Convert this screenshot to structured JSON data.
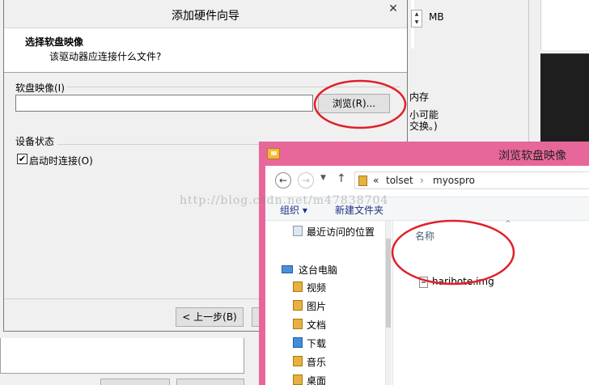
{
  "background_window": {
    "unit_label": "MB",
    "memory_label": "内存",
    "note_line1": "小可能",
    "note_line2": "交换。)"
  },
  "wizard": {
    "title": "添加硬件向导",
    "close_glyph": "✕",
    "heading": "选择软盘映像",
    "subheading": "该驱动器应连接什么文件?",
    "image_group_label": "软盘映像(I)",
    "image_path_value": "",
    "browse_button": "浏览(R)...",
    "device_status_label": "设备状态",
    "connect_at_power_on": "启动时连接(O)",
    "connect_checked": true,
    "back_button": "< 上一步(B)"
  },
  "browse_dialog": {
    "title": "浏览软盘映像",
    "path_prefix": "«",
    "path_segments": [
      "tolset",
      "myospro"
    ],
    "path_separator": "›",
    "toolbar": {
      "organize": "组织 ▾",
      "new_folder": "新建文件夹"
    },
    "nav_items": [
      {
        "label": "最近访问的位置",
        "icon": "recent-locations-icon"
      },
      {
        "label": "这台电脑",
        "icon": "computer-icon"
      },
      {
        "label": "视频",
        "icon": "folder-icon"
      },
      {
        "label": "图片",
        "icon": "folder-icon"
      },
      {
        "label": "文档",
        "icon": "folder-icon"
      },
      {
        "label": "下载",
        "icon": "download-folder-icon"
      },
      {
        "label": "音乐",
        "icon": "folder-icon"
      },
      {
        "label": "桌面",
        "icon": "folder-icon"
      }
    ],
    "column_header": "名称",
    "files": [
      {
        "name": "haribote.img",
        "icon": "file-icon"
      }
    ]
  },
  "watermark": "http://blog.csdn.net/m47838704",
  "annotation_color": "#e0202a",
  "colors": {
    "browse_titlebar": "#e8679a",
    "link_blue": "#1e3287"
  }
}
